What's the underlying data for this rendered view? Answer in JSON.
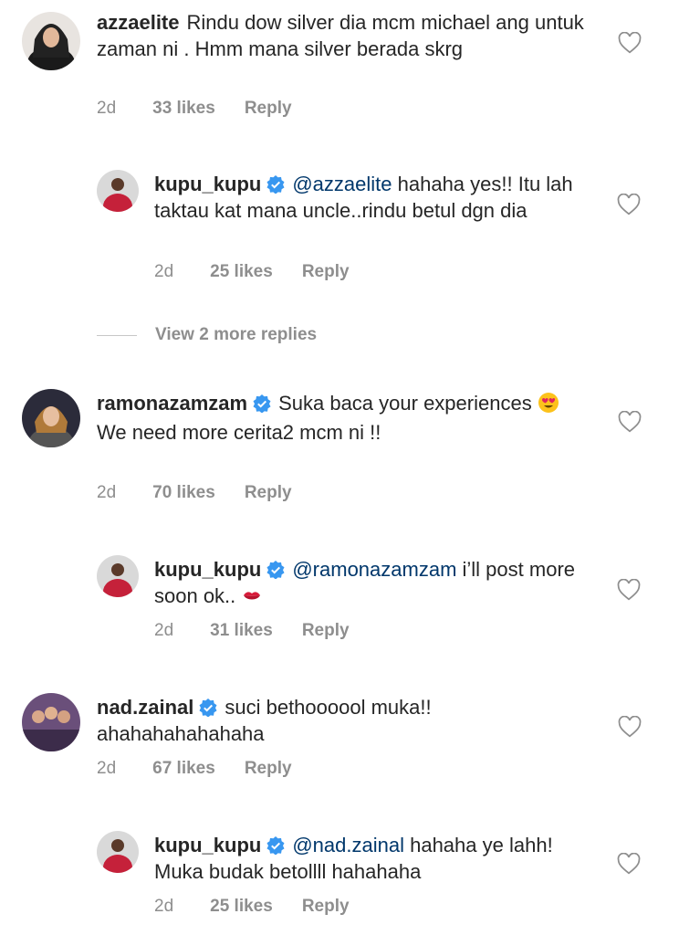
{
  "colors": {
    "text": "#262626",
    "muted": "#8e8e8e",
    "mention": "#00376b",
    "verified": "#3897f0"
  },
  "comments": [
    {
      "username": "azzaelite",
      "verified": false,
      "text": "Rindu dow silver dia mcm michael ang untuk zaman ni . Hmm mana silver berada skrg",
      "time": "2d",
      "likes": "33 likes",
      "reply": "Reply",
      "icons": {
        "like": "heart-outline-icon",
        "avatar": "avatar-azzaelite"
      }
    },
    {
      "username": "kupu_kupu",
      "verified": true,
      "mention": "@azzaelite",
      "text": " hahaha yes!! Itu lah taktau kat mana uncle..rindu betul dgn dia",
      "time": "2d",
      "likes": "25 likes",
      "reply": "Reply"
    },
    {
      "view_more": "View 2 more replies"
    },
    {
      "username": "ramonazamzam",
      "verified": true,
      "text_line1": "Suka baca your experiences",
      "emoji": "heart-eyes-emoji",
      "text_line2": "We need more cerita2 mcm ni !!",
      "time": "2d",
      "likes": "70 likes",
      "reply": "Reply"
    },
    {
      "username": "kupu_kupu",
      "verified": true,
      "mention": "@ramonazamzam",
      "text": " i’ll post more soon ok..",
      "emoji": "kiss-mark-emoji",
      "time": "2d",
      "likes": "31 likes",
      "reply": "Reply"
    },
    {
      "username": "nad.zainal",
      "verified": true,
      "text": "suci bethoooool muka!! ahahahahahahaha",
      "time": "2d",
      "likes": "67 likes",
      "reply": "Reply"
    },
    {
      "username": "kupu_kupu",
      "verified": true,
      "mention": "@nad.zainal",
      "text": " hahaha ye lahh! Muka budak betollll hahahaha",
      "time": "2d",
      "likes": "25 likes",
      "reply": "Reply"
    }
  ]
}
